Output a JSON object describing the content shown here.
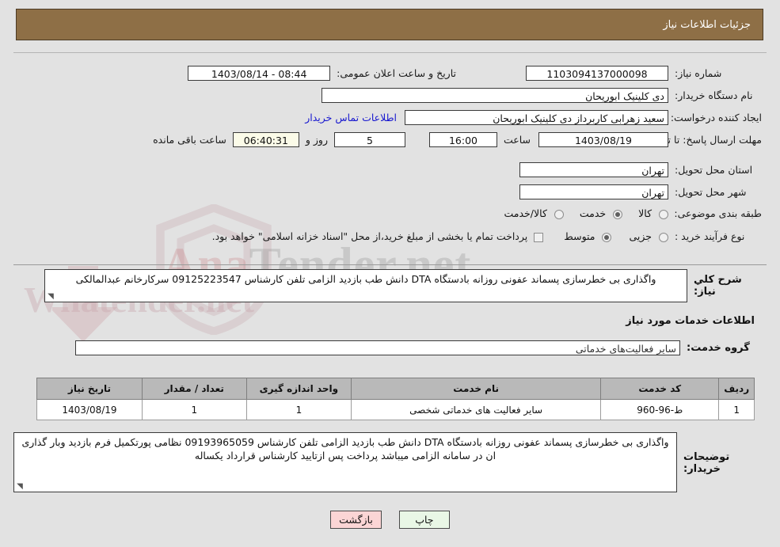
{
  "header": {
    "title": "جزئیات اطلاعات نیاز",
    "bg_color": "#8e6f46"
  },
  "form": {
    "need_number_label": "شماره نیاز:",
    "need_number_value": "1103094137000098",
    "announce_label": "تاریخ و ساعت اعلان عمومی:",
    "announce_value": "1403/08/14 - 08:44",
    "buyer_org_label": "نام دستگاه خریدار:",
    "buyer_org_value": "دی کلینیک ابوریحان",
    "creator_label": "ایجاد کننده درخواست:",
    "creator_value": "سعید زهرابی کاربرداز دی کلینیک ابوریحان",
    "contact_link": "اطلاعات تماس خریدار",
    "deadline_label": "مهلت ارسال پاسخ: تا تاریخ:",
    "deadline_date": "1403/08/19",
    "hour_label": "ساعت",
    "deadline_time": "16:00",
    "days_value": "5",
    "days_label": "روز و",
    "timer_value": "06:40:31",
    "timer_label": "ساعت باقی مانده",
    "province_label": "استان محل تحویل:",
    "province_value": "تهران",
    "city_label": "شهر محل تحویل:",
    "city_value": "تهران",
    "category_label": "طبقه بندی موضوعی:",
    "category_options": [
      {
        "label": "کالا",
        "selected": false
      },
      {
        "label": "خدمت",
        "selected": true
      },
      {
        "label": "کالا/خدمت",
        "selected": false
      }
    ],
    "process_label": "نوع فرآیند خرید :",
    "process_options": [
      {
        "label": "جزیی",
        "selected": false
      },
      {
        "label": "متوسط",
        "selected": true
      }
    ],
    "treasury_note": "پرداخت تمام یا بخشی از مبلغ خرید،از محل \"اسناد خزانه اسلامی\" خواهد بود.",
    "treasury_checked": false
  },
  "description": {
    "label": "شرح کلي نیاز:",
    "value": "واگذاری بی خطرسازی پسماند عفونی روزانه بادستگاه DTA دانش طب بازدید الزامی تلفن کارشناس 09125223547 سرکارخانم عبدالمالکی"
  },
  "services": {
    "section_title": "اطلاعات خدمات مورد نیاز",
    "group_label": "گروه خدمت:",
    "group_value": "سایر فعالیت‌های خدماتی",
    "columns": [
      "ردیف",
      "کد خدمت",
      "نام خدمت",
      "واحد اندازه گیری",
      "تعداد / مقدار",
      "تاریخ نیاز"
    ],
    "rows": [
      {
        "row": "1",
        "code": "ط-96-960",
        "name": "سایر فعالیت های خدماتی شخصی",
        "unit": "1",
        "quantity": "1",
        "need_date": "1403/08/19"
      }
    ]
  },
  "buyer_notes": {
    "label": "توضیحات خریدار:",
    "value": "واگذاری بی خطرسازی پسماند عفونی روزانه بادستگاه DTA دانش طب بازدید الزامی تلفن کارشناس 09193965059 نظامی پورتکمیل فرم بازدید وبار گذاری ان در سامانه الزامی میباشد پرداخت پس ازتایید کارشناس قرارداد یکساله"
  },
  "buttons": {
    "print": "چاپ",
    "back": "بازگشت"
  },
  "watermark": {
    "text_left": "Ana",
    "text_right": "Tender.net",
    "lower_text": "Wnatender.net"
  }
}
